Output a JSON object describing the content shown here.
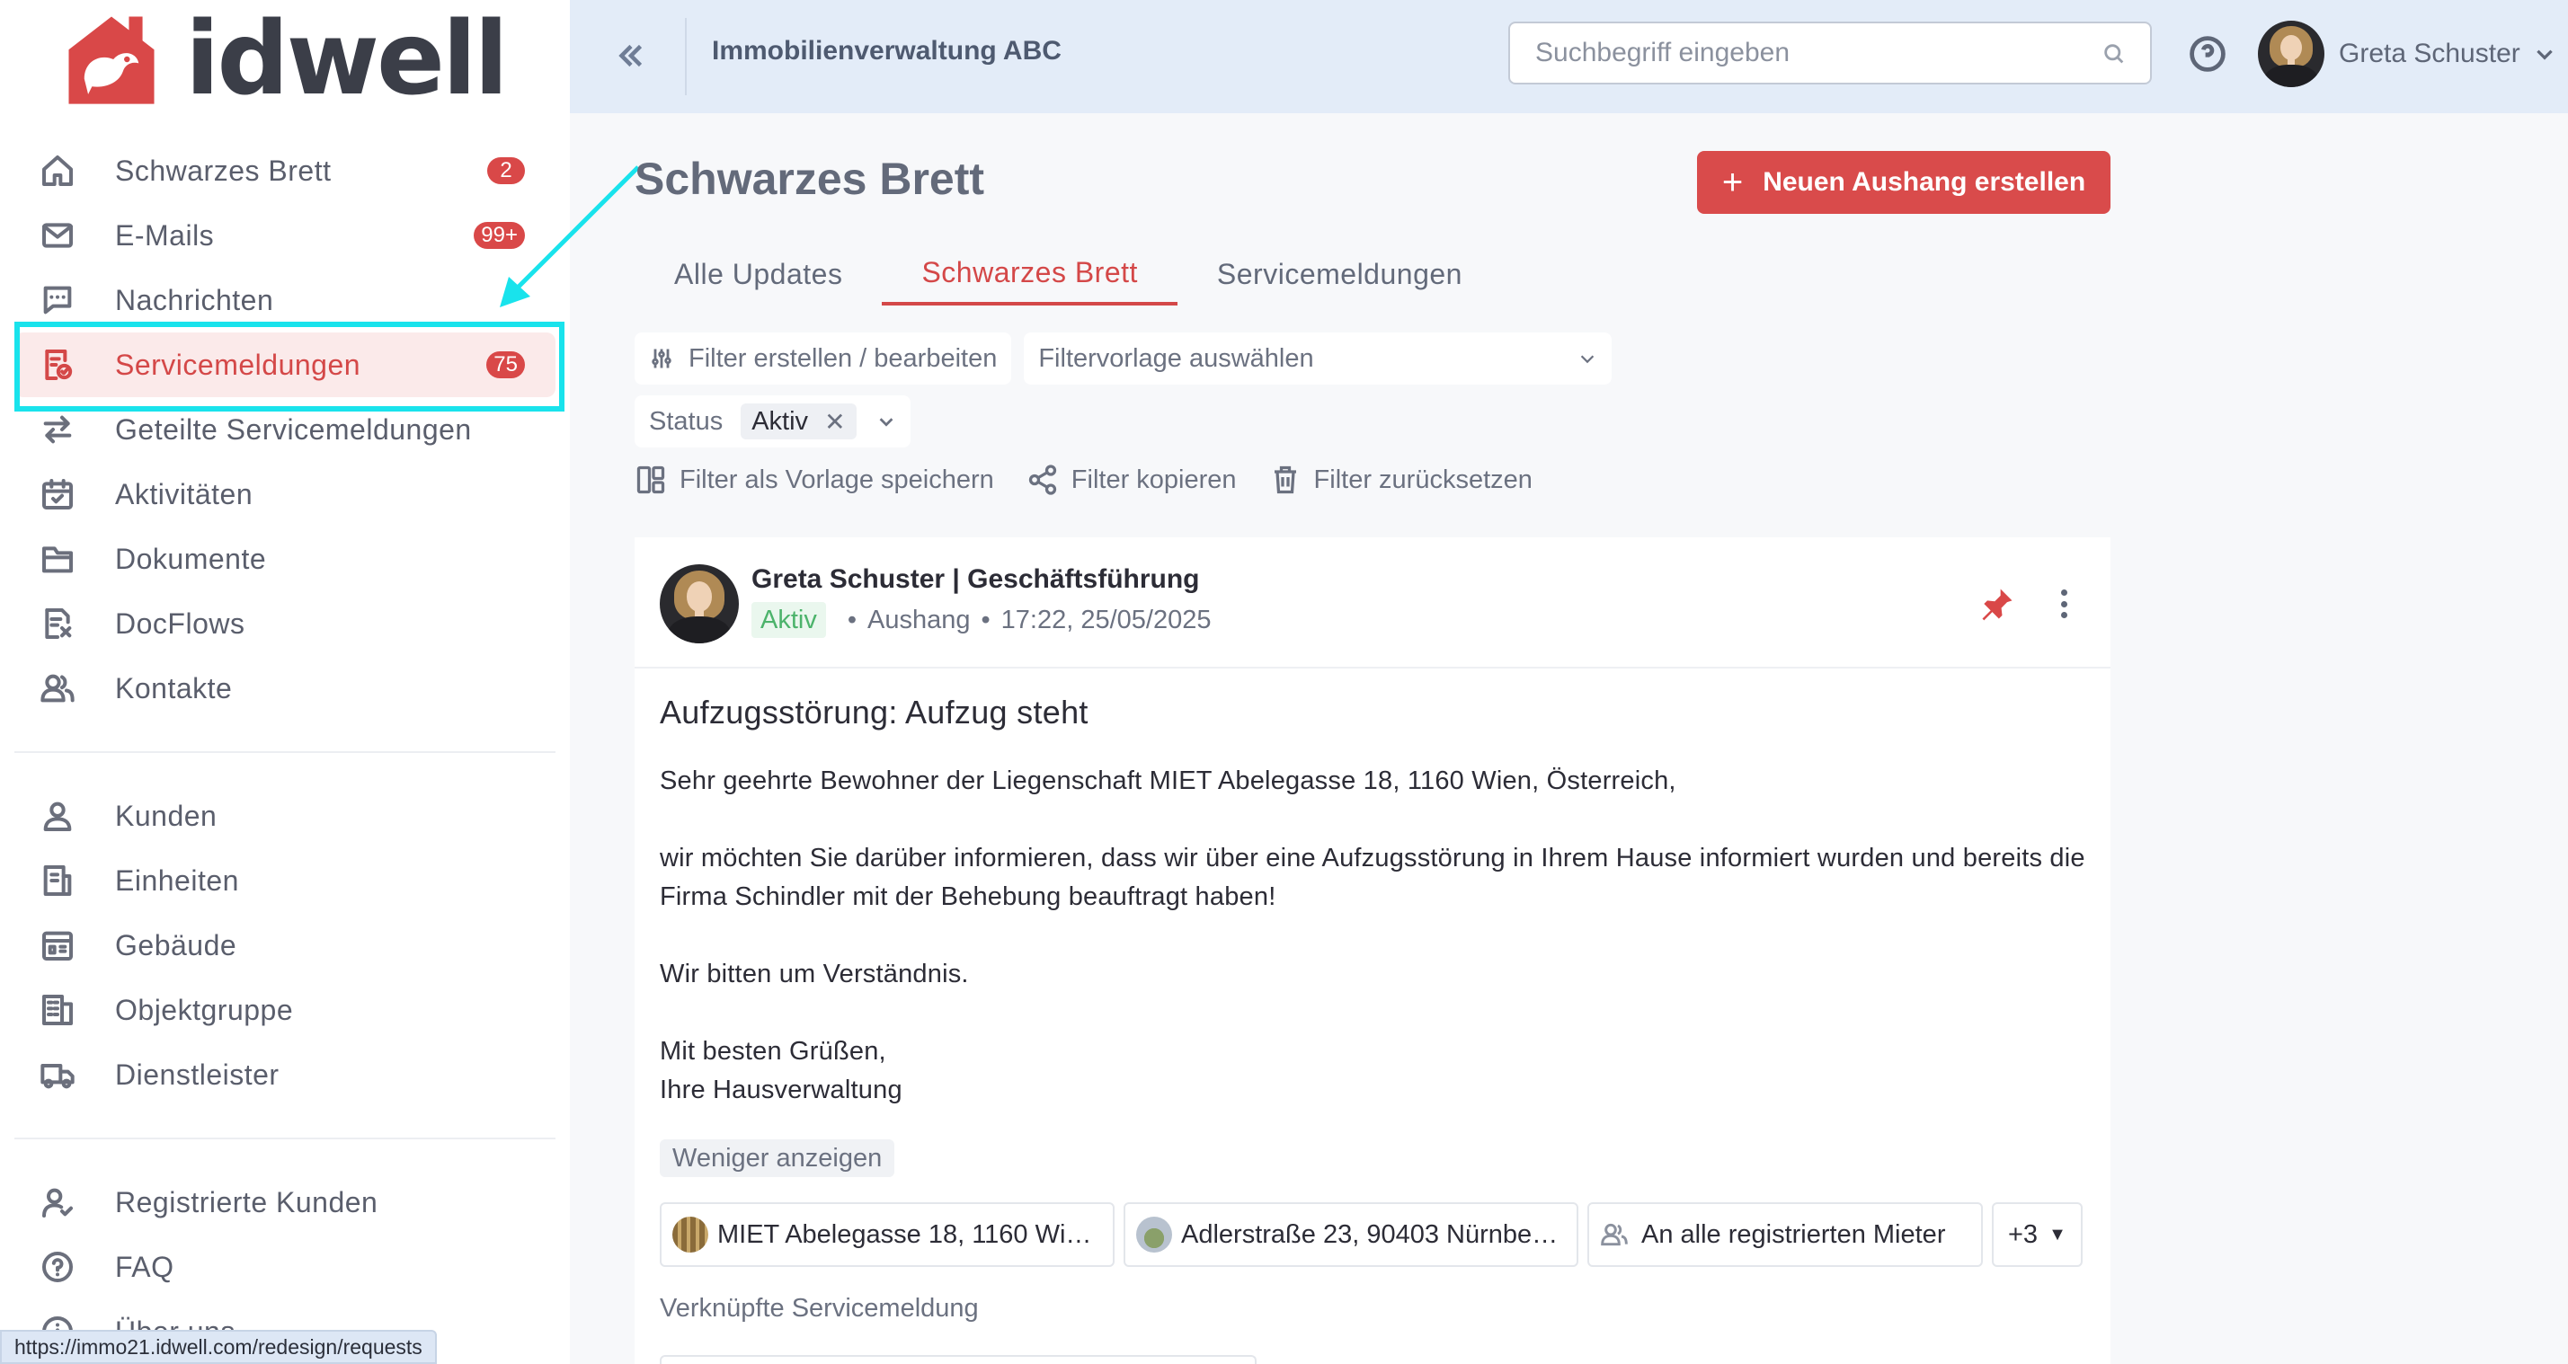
{
  "brand": {
    "name": "idwell",
    "accent": "#d94848"
  },
  "sidebar": {
    "group1": [
      {
        "label": "Schwarzes Brett",
        "icon": "home-icon",
        "badge": "2"
      },
      {
        "label": "E-Mails",
        "icon": "mail-icon",
        "badge": "99+"
      },
      {
        "label": "Nachrichten",
        "icon": "chat-icon",
        "badge": ""
      },
      {
        "label": "Servicemeldungen",
        "icon": "service-icon",
        "badge": "75",
        "active": true
      },
      {
        "label": "Geteilte Servicemeldungen",
        "icon": "share-arrows-icon",
        "badge": ""
      },
      {
        "label": "Aktivitäten",
        "icon": "calendar-check-icon",
        "badge": ""
      },
      {
        "label": "Dokumente",
        "icon": "folder-icon",
        "badge": ""
      },
      {
        "label": "DocFlows",
        "icon": "docflow-icon",
        "badge": ""
      },
      {
        "label": "Kontakte",
        "icon": "contacts-icon",
        "badge": ""
      }
    ],
    "group2": [
      {
        "label": "Kunden",
        "icon": "user-icon"
      },
      {
        "label": "Einheiten",
        "icon": "unit-icon"
      },
      {
        "label": "Gebäude",
        "icon": "building-icon"
      },
      {
        "label": "Objektgruppe",
        "icon": "object-group-icon"
      },
      {
        "label": "Dienstleister",
        "icon": "truck-icon"
      }
    ],
    "group3": [
      {
        "label": "Registrierte Kunden",
        "icon": "user-check-icon"
      },
      {
        "label": "FAQ",
        "icon": "question-icon"
      },
      {
        "label": "Über uns",
        "icon": "info-icon"
      }
    ]
  },
  "status_bar": {
    "url": "https://immo21.idwell.com/redesign/requests"
  },
  "topbar": {
    "org_name": "Immobilienverwaltung ABC",
    "search_placeholder": "Suchbegriff eingeben",
    "user_name": "Greta Schuster"
  },
  "main": {
    "title": "Schwarzes Brett",
    "create_button": "Neuen Aushang erstellen",
    "tabs": [
      {
        "label": "Alle Updates",
        "active": false
      },
      {
        "label": "Schwarzes Brett",
        "active": true
      },
      {
        "label": "Servicemeldungen",
        "active": false
      }
    ],
    "filters": {
      "edit_label": "Filter erstellen / bearbeiten",
      "template_placeholder": "Filtervorlage auswählen",
      "status_label": "Status",
      "status_value": "Aktiv",
      "save_template": "Filter als Vorlage speichern",
      "copy_filter": "Filter kopieren",
      "reset_filter": "Filter zurücksetzen"
    }
  },
  "post": {
    "author": "Greta Schuster | Geschäftsführung",
    "status": "Aktiv",
    "type": "Aushang",
    "timestamp": "17:22, 25/05/2025",
    "title": "Aufzugsstörung: Aufzug steht",
    "body": {
      "p1": "Sehr geehrte Bewohner der Liegenschaft MIET Abelegasse 18, 1160 Wien, Österreich,",
      "p2": "wir möchten Sie darüber informieren, dass wir über eine Aufzugsstörung in Ihrem Hause informiert wurden und bereits die Firma Schindler mit der Behebung beauftragt haben!",
      "p3": "Wir bitten um Verständnis.",
      "p4a": "Mit besten Grüßen,",
      "p4b": "Ihre Hausverwaltung"
    },
    "show_less": "Weniger anzeigen",
    "recipients": [
      "MIET Abelegasse 18, 1160 Wi…",
      "Adlerstraße 23, 90403 Nürnbe…",
      "An alle registrierten Mieter"
    ],
    "more_recipients": "+3",
    "linked_label": "Verknüpfte Servicemeldung"
  }
}
